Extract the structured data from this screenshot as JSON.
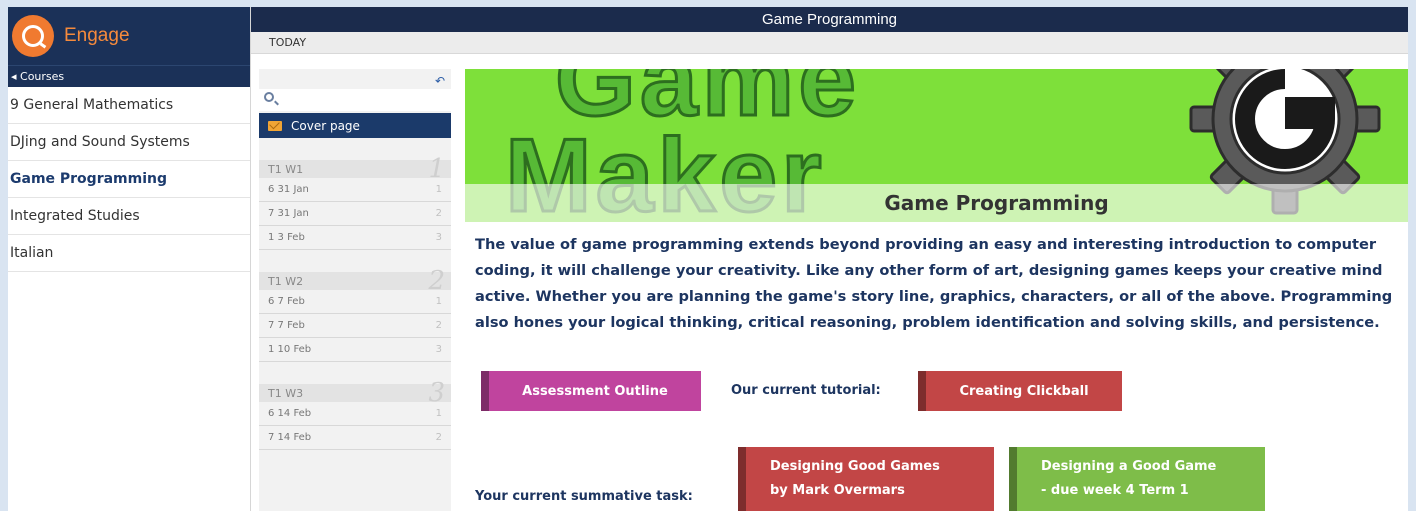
{
  "app": {
    "name": "Engage"
  },
  "sidebar": {
    "courses_label": "◂ Courses",
    "items": [
      {
        "label": "9 General Mathematics",
        "active": false
      },
      {
        "label": "DJing and Sound Systems",
        "active": false
      },
      {
        "label": "Game Programming",
        "active": true
      },
      {
        "label": "Integrated Studies",
        "active": false
      },
      {
        "label": "Italian",
        "active": false
      }
    ]
  },
  "header": {
    "title": "Game Programming",
    "today": "TODAY"
  },
  "lessons": {
    "search_placeholder": "",
    "cover_label": "Cover page",
    "weeks": [
      {
        "label": "T1  W1",
        "number": "1",
        "rows": [
          {
            "label": "6  31 Jan",
            "idx": "1"
          },
          {
            "label": "7  31 Jan",
            "idx": "2"
          },
          {
            "label": "1  3 Feb",
            "idx": "3"
          }
        ]
      },
      {
        "label": "T1  W2",
        "number": "2",
        "rows": [
          {
            "label": "6  7 Feb",
            "idx": "1"
          },
          {
            "label": "7  7 Feb",
            "idx": "2"
          },
          {
            "label": "1  10 Feb",
            "idx": "3"
          }
        ]
      },
      {
        "label": "T1  W3",
        "number": "3",
        "rows": [
          {
            "label": "6  14 Feb",
            "idx": "1"
          },
          {
            "label": "7  14 Feb",
            "idx": "2"
          }
        ]
      }
    ]
  },
  "main": {
    "banner_text_line1": "Game",
    "banner_text_line2": "Maker",
    "banner_title": "Game Programming",
    "description": "The value of game programming extends beyond providing an easy and interesting introduction to computer coding, it will challenge your creativity. Like any other form of art, designing games keeps your creative mind active. Whether you are planning the game's story line, graphics, characters, or all of the above. Programming also hones your logical thinking, critical reasoning, problem identification and solving skills, and persistence.",
    "assessment_button": "Assessment Outline",
    "tutorial_label": "Our current tutorial:",
    "tutorial_button": "Creating Clickball",
    "summative_label": "Your current summative task:",
    "design_button_1": "Designing Good Games\nby Mark Overmars",
    "design_button_2": "Designing a Good Game\n- due week 4 Term 1"
  },
  "colors": {
    "navy": "#1b3158",
    "brand_orange": "#f07a30",
    "banner_green": "#7ee03a",
    "assessment_pink": "#c0449e",
    "task_red": "#c24646",
    "task_green": "#7ebd49"
  }
}
